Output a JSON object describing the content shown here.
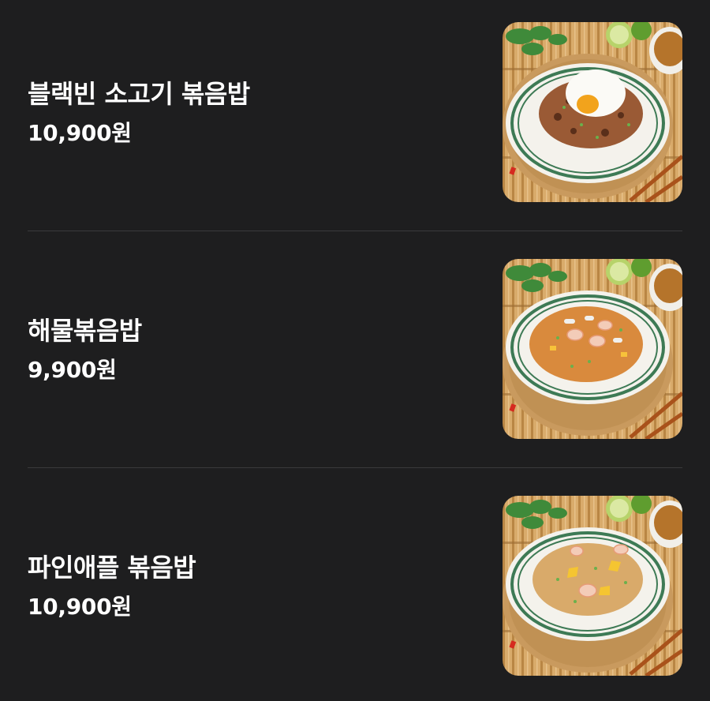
{
  "menu": {
    "items": [
      {
        "name": "블랙빈 소고기 볶음밥",
        "price": "10,900원",
        "photo_icon": "fried-rice-photo",
        "rice_color": "#9a5a35",
        "topping": "egg"
      },
      {
        "name": "해물볶음밥",
        "price": "9,900원",
        "photo_icon": "fried-rice-photo",
        "rice_color": "#d98a3d",
        "topping": "shrimp"
      },
      {
        "name": "파인애플 볶음밥",
        "price": "10,900원",
        "photo_icon": "fried-rice-photo",
        "rice_color": "#d9aa6a",
        "topping": "pineapple"
      }
    ]
  },
  "colors": {
    "background": "#1e1e1f",
    "divider": "#3a3a3c",
    "text": "#ffffff",
    "bamboo": "#d7a866",
    "plate_rim": "#3d7a55"
  }
}
